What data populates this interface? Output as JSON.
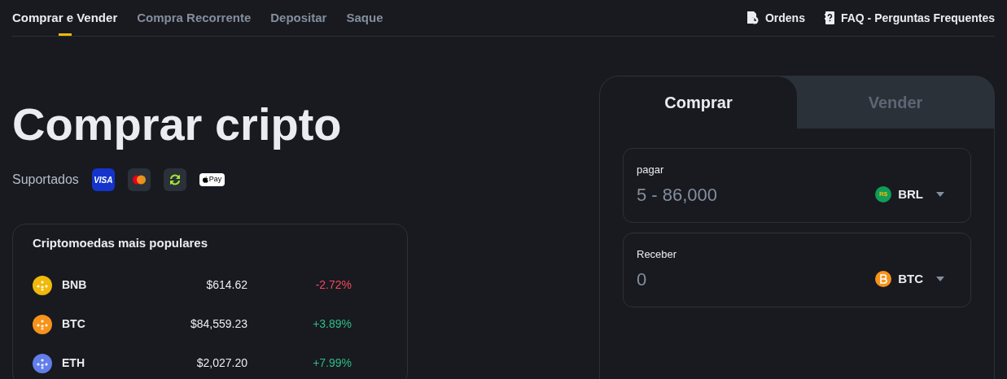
{
  "nav": {
    "tabs": [
      {
        "label": "Comprar e Vender",
        "selected": true
      },
      {
        "label": "Compra Recorrente",
        "selected": false
      },
      {
        "label": "Depositar",
        "selected": false
      },
      {
        "label": "Saque",
        "selected": false
      }
    ],
    "links": [
      {
        "kind": "orders",
        "label": "Ordens"
      },
      {
        "kind": "faq",
        "label": "FAQ - Perguntas Frequentes"
      }
    ]
  },
  "hero": {
    "title": "Comprar cripto",
    "supported_label": "Suportados",
    "payment_methods": [
      {
        "kind": "visa",
        "label": "VISA"
      },
      {
        "kind": "mastercard"
      },
      {
        "kind": "transfer"
      },
      {
        "kind": "applepay",
        "label": "Pay"
      }
    ]
  },
  "popular": {
    "title": "Criptomoedas mais populares",
    "rows": [
      {
        "symbol": "BNB",
        "price": "$614.62",
        "change": "-2.72%",
        "color": "#f0b90b"
      },
      {
        "symbol": "BTC",
        "price": "$84,559.23",
        "change": "+3.89%",
        "color": "#f7931a"
      },
      {
        "symbol": "ETH",
        "price": "$2,027.20",
        "change": "+7.99%",
        "color": "#627eea"
      }
    ]
  },
  "trade": {
    "tabs": [
      {
        "label": "Comprar",
        "selected": true
      },
      {
        "label": "Vender",
        "selected": false
      }
    ],
    "fields": [
      {
        "label": "pagar",
        "placeholder": "5 - 86,000",
        "currency": "BRL",
        "icon_text": "R$",
        "color": "#0f9d58"
      },
      {
        "label": "Receber",
        "placeholder": "0",
        "currency": "BTC",
        "color": "#f7931a"
      }
    ]
  }
}
